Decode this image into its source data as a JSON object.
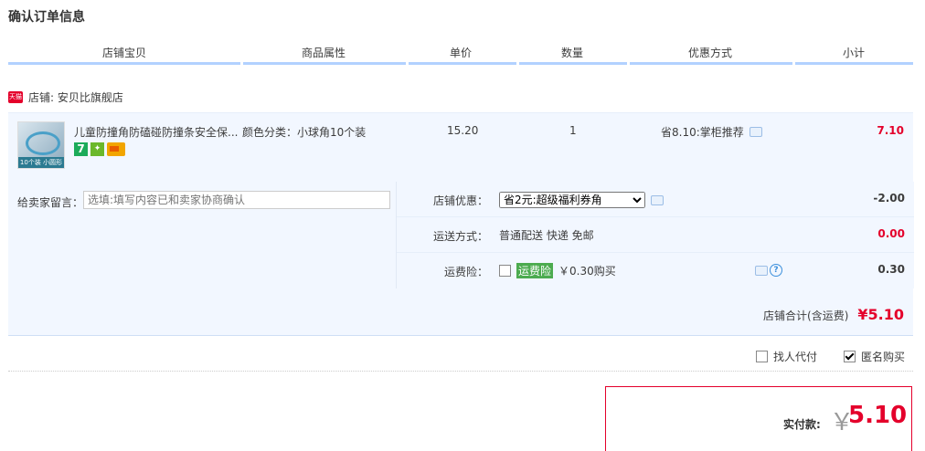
{
  "page_title": "确认订单信息",
  "columns": [
    "店铺宝贝",
    "商品属性",
    "单价",
    "数量",
    "优惠方式",
    "小计"
  ],
  "shop": {
    "badge": "天猫",
    "label": "店铺: 安贝比旗舰店"
  },
  "item": {
    "thumb_caption": "10个装 小圆形",
    "name": "儿童防撞角防磕碰防撞条安全保...",
    "attr": "颜色分类：小球角10个装",
    "price": "15.20",
    "qty": "1",
    "promo": "省8.10:掌柜推荐",
    "subtotal": "7.10",
    "badge_7": "7"
  },
  "message": {
    "label": "给卖家留言：",
    "placeholder": "选填:填写内容已和卖家协商确认"
  },
  "shop_discount": {
    "label": "店铺优惠：",
    "selected": "省2元:超级福利券角",
    "amount": "-2.00"
  },
  "shipping": {
    "label": "运送方式：",
    "value": "普通配送 快递 免邮",
    "amount": "0.00"
  },
  "insurance": {
    "label": "运费险：",
    "tag": "运费险",
    "value": "￥0.30购买",
    "amount": "0.30",
    "help": "?"
  },
  "shop_total": {
    "label": "店铺合计(含运费)",
    "value": "¥5.10"
  },
  "options": {
    "proxy": "找人代付",
    "anonymous": "匿名购买"
  },
  "payment": {
    "label": "实付款:",
    "currency": "￥",
    "value": "5.10"
  },
  "colors": {
    "accent_red": "#e4002b",
    "header_line": "#b2d1ff",
    "panel_bg": "#f2f7ff"
  }
}
